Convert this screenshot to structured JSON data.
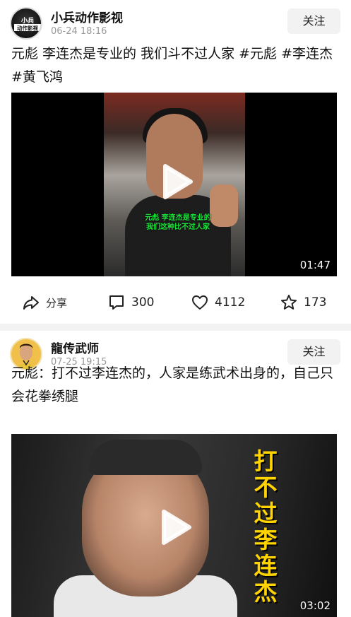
{
  "posts": [
    {
      "avatar_text": [
        "小兵",
        "动作影视"
      ],
      "author": "小兵动作影视",
      "time": "06-24 18:16",
      "follow_label": "关注",
      "caption": "元彪 李连杰是专业的 我们斗不过人家 #元彪 #李连杰 #黄飞鸿",
      "video": {
        "subtitle_line1": "元彪 李连杰是专业的",
        "subtitle_line2": "我们这种比不过人家",
        "duration": "01:47"
      },
      "actions": {
        "share_label": "分享",
        "comments": "300",
        "likes": "4112",
        "favorites": "173"
      }
    },
    {
      "author": "龍传武师",
      "time": "07-25 19:15",
      "follow_label": "关注",
      "caption": "元彪：打不过李连杰的，人家是练武术出身的，自己只会花拳绣腿",
      "video": {
        "overlay_text": "打不过李连杰",
        "duration": "03:02"
      }
    }
  ],
  "icons": {
    "play": "play-icon",
    "share": "share-icon",
    "comment": "comment-icon",
    "like": "heart-icon",
    "favorite": "star-icon"
  },
  "colors": {
    "subtitle_green": "#19e83a",
    "overlay_yellow": "#ffd400",
    "follow_bg": "#f2f2f2",
    "time_gray": "#999999"
  }
}
